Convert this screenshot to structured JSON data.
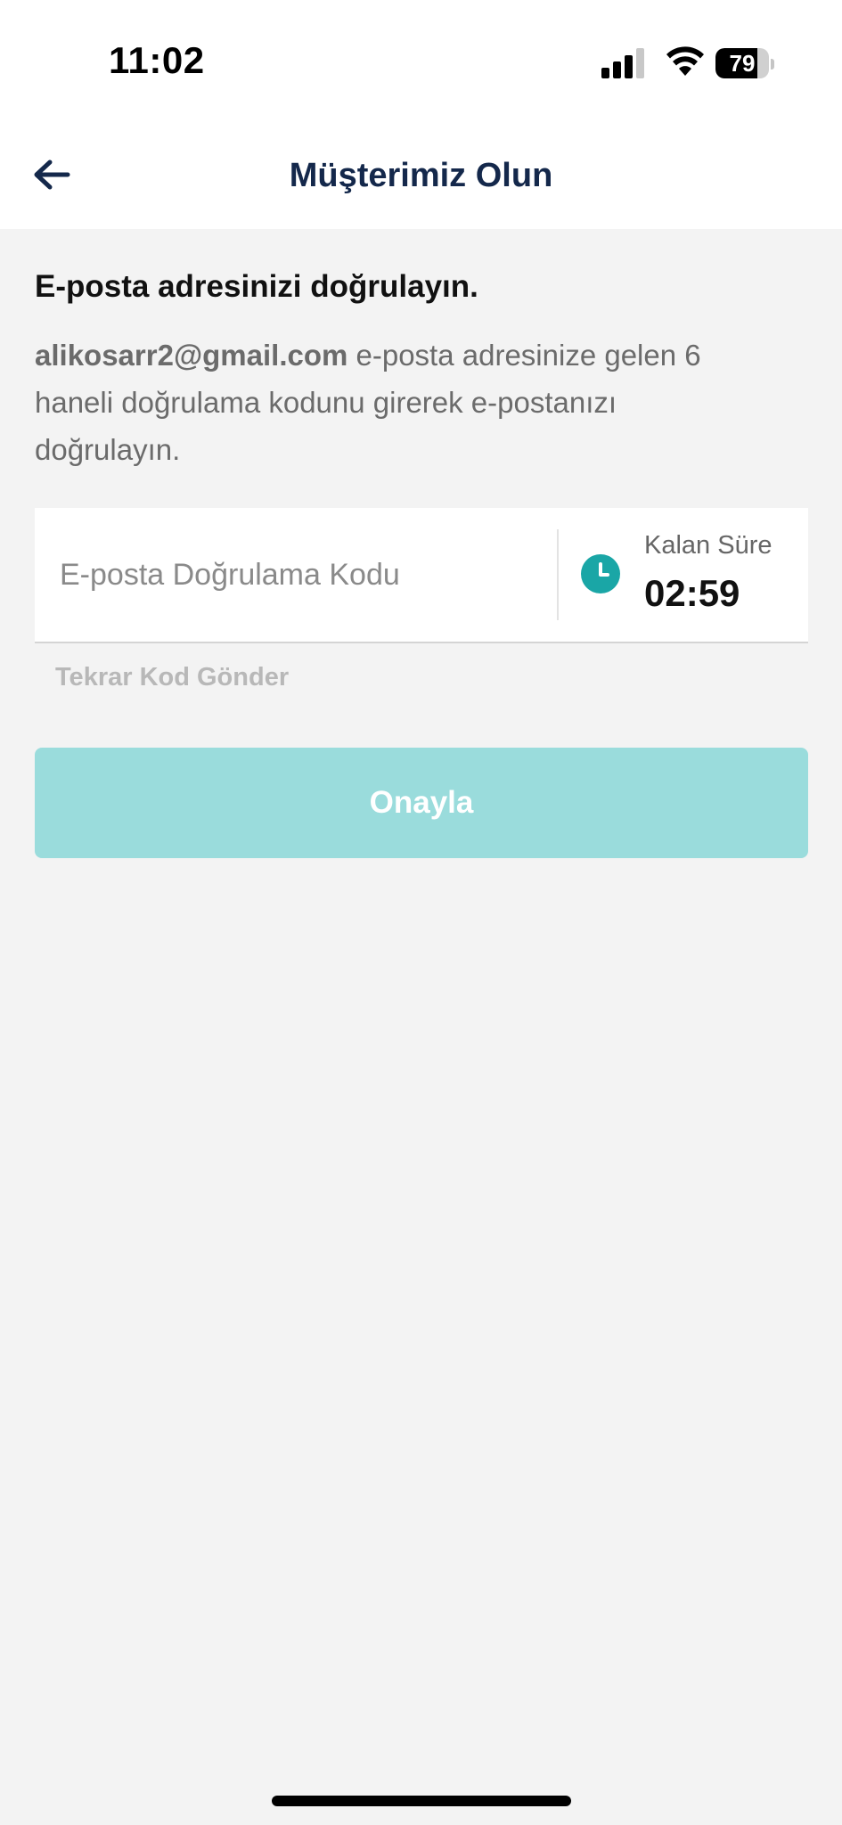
{
  "status_bar": {
    "time": "11:02",
    "battery_level": "79",
    "battery_fraction": 0.79,
    "icons": [
      "signal-icon",
      "wifi-icon",
      "battery-icon"
    ]
  },
  "header": {
    "title": "Müşterimiz Olun",
    "back_icon": "arrow-left-icon"
  },
  "content": {
    "title": "E-posta adresinizi doğrulayın.",
    "email": "alikosarr2@gmail.com",
    "description_suffix": " e-posta adresinize gelen 6 haneli doğrulama kodunu girerek e-postanızı doğrulayın."
  },
  "code_field": {
    "placeholder": "E-posta Doğrulama Kodu",
    "value": "",
    "timer_label": "Kalan Süre",
    "timer_value": "02:59",
    "clock_icon": "clock-icon"
  },
  "actions": {
    "resend_label": "Tekrar Kod Gönder",
    "confirm_label": "Onayla"
  },
  "colors": {
    "accent": "#1aa6a6",
    "button_disabled": "#9adcdc",
    "header_text": "#14284b",
    "background": "#f3f3f3"
  }
}
